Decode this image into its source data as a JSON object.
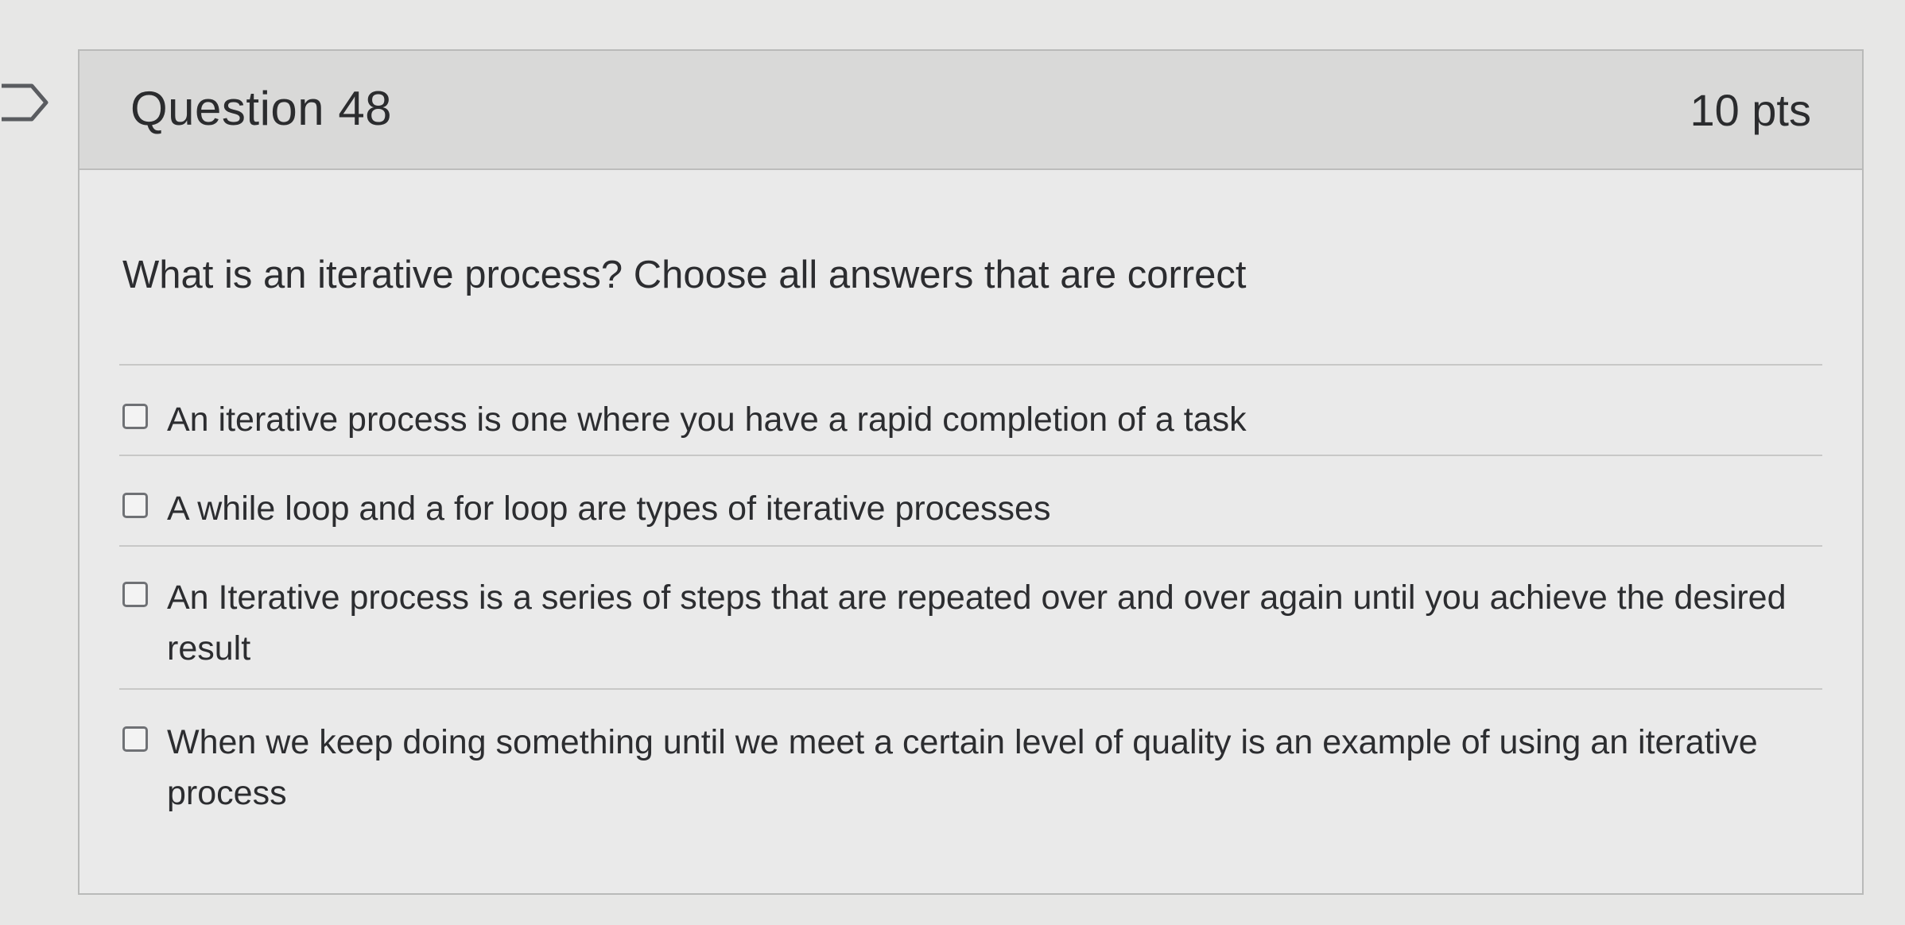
{
  "question": {
    "title": "Question 48",
    "points": "10 pts",
    "text": "What is an iterative process? Choose all answers that are correct",
    "flag_icon": "flag-outline-icon",
    "answers": [
      {
        "label": "An iterative process is one where you have a rapid completion of a task",
        "checked": false
      },
      {
        "label": "A while loop and a for loop are types of iterative processes",
        "checked": false
      },
      {
        "label": "An Iterative process is a series of steps that are repeated over and over again until you achieve the desired result",
        "checked": false
      },
      {
        "label": "When we keep doing something until we meet a certain level of quality is an example of using an iterative process",
        "checked": false
      }
    ]
  },
  "colors": {
    "header_bg": "#d9d9d8",
    "card_bg": "#eaeaea",
    "text": "#2c2d30",
    "border": "#b9bab9"
  }
}
